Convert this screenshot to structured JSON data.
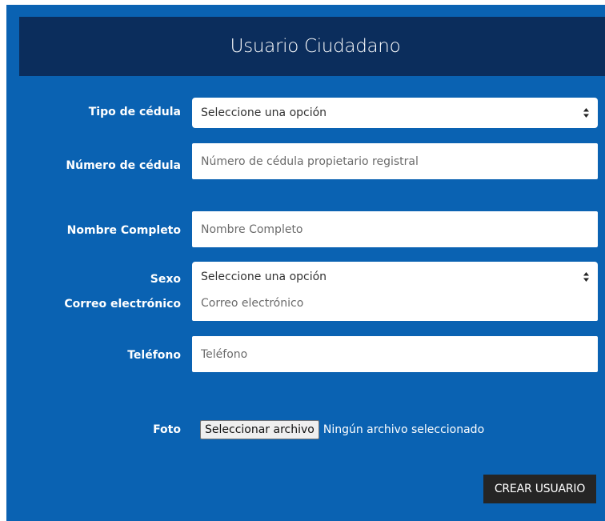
{
  "form": {
    "title": "Usuario Ciudadano",
    "fields": {
      "tipo_cedula": {
        "label": "Tipo de cédula",
        "value": "Seleccione una opción"
      },
      "numero_cedula": {
        "label": "Número de cédula",
        "placeholder": "Número de cédula propietario registral"
      },
      "nombre": {
        "label": "Nombre Completo",
        "placeholder": "Nombre Completo"
      },
      "sexo": {
        "label": "Sexo",
        "value": "Seleccione una opción"
      },
      "correo": {
        "label": "Correo electrónico",
        "placeholder": "Correo electrónico"
      },
      "telefono": {
        "label": "Teléfono",
        "placeholder": "Teléfono"
      },
      "foto": {
        "label": "Foto",
        "button": "Seleccionar archivo",
        "status": "Ningún archivo seleccionado"
      }
    },
    "submit_label": "CREAR USUARIO"
  },
  "colors": {
    "panel": "#0a62b2",
    "header": "#0b2d5c",
    "button": "#252525"
  },
  "icons": {
    "select_caret": "up-down-caret-icon"
  }
}
